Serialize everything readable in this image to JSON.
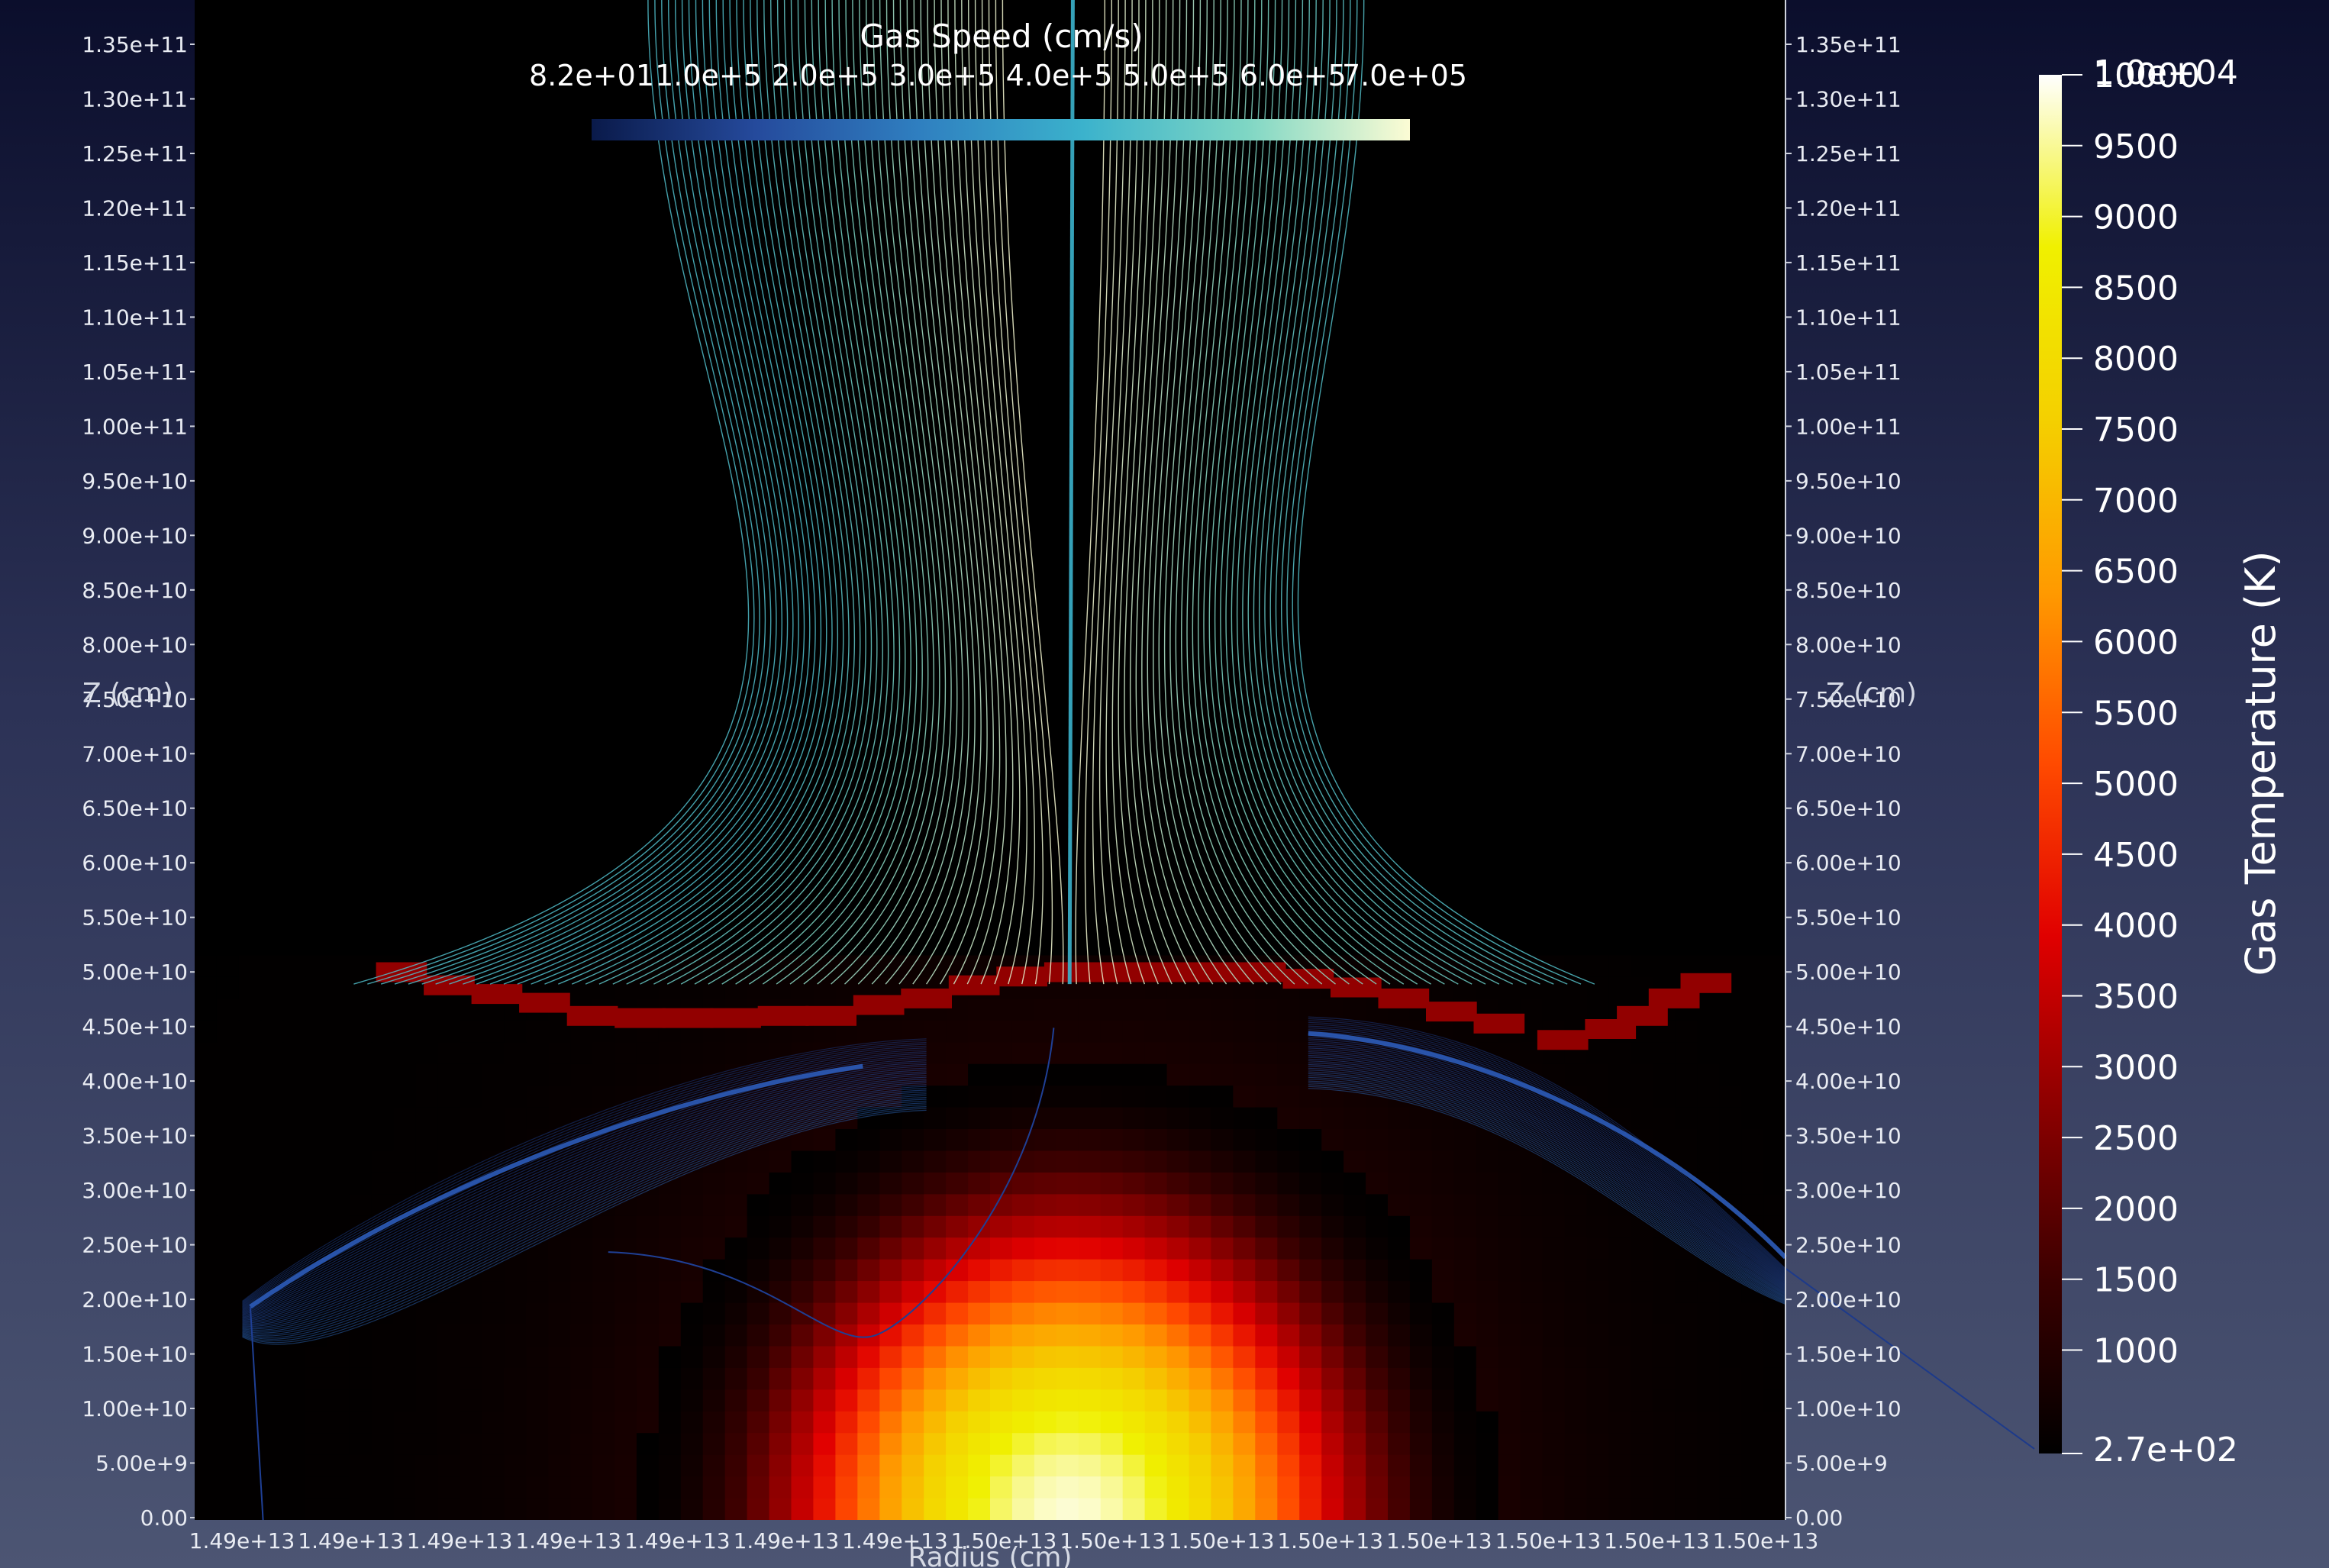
{
  "chart_data": {
    "type": "heatmap",
    "title": "",
    "xlabel": "Radius (cm)",
    "ylabel": "Z (cm)",
    "x_ticks": [
      "1.49e+13",
      "1.49e+13",
      "1.49e+13",
      "1.49e+13",
      "1.49e+13",
      "1.49e+13",
      "1.49e+13",
      "1.50e+13",
      "1.50e+13",
      "1.50e+13",
      "1.50e+13",
      "1.50e+13",
      "1.50e+13",
      "1.50e+13",
      "1.50e+13"
    ],
    "y_ticks": [
      "1.35e+11",
      "1.30e+11",
      "1.25e+11",
      "1.20e+11",
      "1.15e+11",
      "1.10e+11",
      "1.05e+11",
      "1.00e+11",
      "9.50e+10",
      "9.00e+10",
      "8.50e+10",
      "8.00e+10",
      "7.50e+10",
      "7.00e+10",
      "6.50e+10",
      "6.00e+10",
      "5.50e+10",
      "5.00e+10",
      "4.50e+10",
      "4.00e+10",
      "3.50e+10",
      "3.00e+10",
      "2.50e+10",
      "2.00e+10",
      "1.50e+10",
      "1.00e+10",
      "5.00e+9",
      "0.00"
    ],
    "ylim": [
      0,
      139000000000.0
    ],
    "temperature_colorbar": {
      "title": "Gas Temperature (K)",
      "min": 270,
      "max": 10000,
      "min_label": "2.7e+02",
      "max_label": "1.0e+04",
      "ticks": [
        "10000",
        "9500",
        "9000",
        "8500",
        "8000",
        "7500",
        "7000",
        "6500",
        "6000",
        "5500",
        "5000",
        "4500",
        "4000",
        "3500",
        "3000",
        "2500",
        "2000",
        "1500",
        "1000"
      ],
      "tick_values": [
        10000,
        9500,
        9000,
        8500,
        8000,
        7500,
        7000,
        6500,
        6000,
        5500,
        5000,
        4500,
        4000,
        3500,
        3000,
        2500,
        2000,
        1500,
        1000
      ],
      "colormap": [
        "#000000",
        "#3a0000",
        "#8b0000",
        "#e00000",
        "#ff4a00",
        "#ff9a00",
        "#f4d000",
        "#f0f000",
        "#ffffff"
      ]
    },
    "speed_colorbar": {
      "title": "Gas Speed (cm/s)",
      "min": 82,
      "max": 700000,
      "labels": [
        "8.2e+01",
        "1.0e+5",
        "2.0e+5",
        "3.0e+5",
        "4.0e+5",
        "5.0e+5",
        "6.0e+5",
        "7.0e+05"
      ],
      "label_values": [
        82,
        100000,
        200000,
        300000,
        400000,
        500000,
        600000,
        700000
      ],
      "colormap": [
        "#0a1a4a",
        "#254a9c",
        "#2f7fc0",
        "#3bb2cc",
        "#7ed6c4",
        "#fcfcd4"
      ]
    },
    "temperature_field": [
      {
        "x": 0.55,
        "z": 0.0,
        "T": 9800
      },
      {
        "x": 0.57,
        "z": 500000000.0,
        "T": 9500
      },
      {
        "x": 0.55,
        "z": 10000000000.0,
        "T": 8600
      },
      {
        "x": 0.55,
        "z": 20000000000.0,
        "T": 6500
      },
      {
        "x": 0.55,
        "z": 30000000000.0,
        "T": 3800
      },
      {
        "x": 0.55,
        "z": 40000000000.0,
        "T": 1200
      },
      {
        "x": 0.55,
        "z": 80000000000.0,
        "T": 300
      }
    ],
    "front": {
      "z": 48000000000.0,
      "T": 2800
    }
  }
}
